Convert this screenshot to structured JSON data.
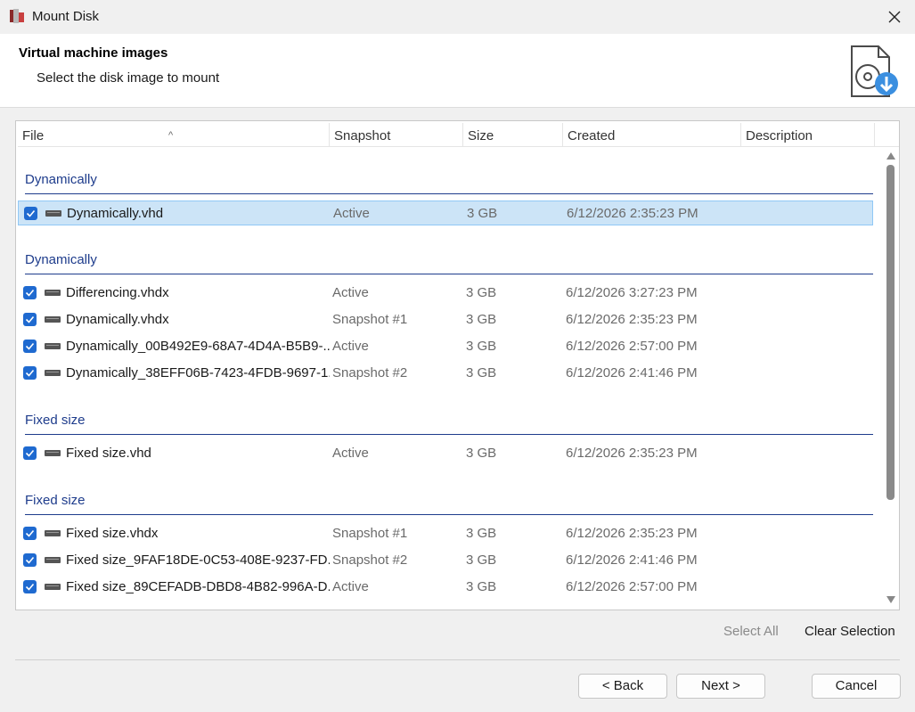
{
  "window": {
    "title": "Mount Disk"
  },
  "header": {
    "title": "Virtual machine images",
    "subtitle": "Select the disk image to mount"
  },
  "columns": {
    "file": "File",
    "snapshot": "Snapshot",
    "size": "Size",
    "created": "Created",
    "description": "Description"
  },
  "groups": [
    {
      "label": "Dynamically",
      "rows": [
        {
          "file": "Dynamically.vhd",
          "snapshot": "Active",
          "size": "3 GB",
          "created": "6/12/2026 2:35:23 PM",
          "checked": true,
          "selected": true
        }
      ]
    },
    {
      "label": "Dynamically",
      "rows": [
        {
          "file": "Differencing.vhdx",
          "snapshot": "Active",
          "size": "3 GB",
          "created": "6/12/2026 3:27:23 PM",
          "checked": true
        },
        {
          "file": "Dynamically.vhdx",
          "snapshot": "Snapshot #1",
          "size": "3 GB",
          "created": "6/12/2026 2:35:23 PM",
          "checked": true
        },
        {
          "file": "Dynamically_00B492E9-68A7-4D4A-B5B9-...",
          "snapshot": "Active",
          "size": "3 GB",
          "created": "6/12/2026 2:57:00 PM",
          "checked": true
        },
        {
          "file": "Dynamically_38EFF06B-7423-4FDB-9697-1...",
          "snapshot": "Snapshot #2",
          "size": "3 GB",
          "created": "6/12/2026 2:41:46 PM",
          "checked": true
        }
      ]
    },
    {
      "label": "Fixed size",
      "rows": [
        {
          "file": "Fixed size.vhd",
          "snapshot": "Active",
          "size": "3 GB",
          "created": "6/12/2026 2:35:23 PM",
          "checked": true
        }
      ]
    },
    {
      "label": "Fixed size",
      "rows": [
        {
          "file": "Fixed size.vhdx",
          "snapshot": "Snapshot #1",
          "size": "3 GB",
          "created": "6/12/2026 2:35:23 PM",
          "checked": true
        },
        {
          "file": "Fixed size_9FAF18DE-0C53-408E-9237-FD...",
          "snapshot": "Snapshot #2",
          "size": "3 GB",
          "created": "6/12/2026 2:41:46 PM",
          "checked": true
        },
        {
          "file": "Fixed size_89CEFADB-DBD8-4B82-996A-D...",
          "snapshot": "Active",
          "size": "3 GB",
          "created": "6/12/2026 2:57:00 PM",
          "checked": true
        }
      ]
    }
  ],
  "actions": {
    "select_all": "Select All",
    "clear_selection": "Clear Selection"
  },
  "buttons": {
    "back": "< Back",
    "next": "Next >",
    "cancel": "Cancel"
  },
  "colors": {
    "group_label": "#1e3c8c",
    "checkbox": "#1f6ad0",
    "selected_row": "#cce4f7",
    "disabled_text": "#8a8a8a"
  }
}
